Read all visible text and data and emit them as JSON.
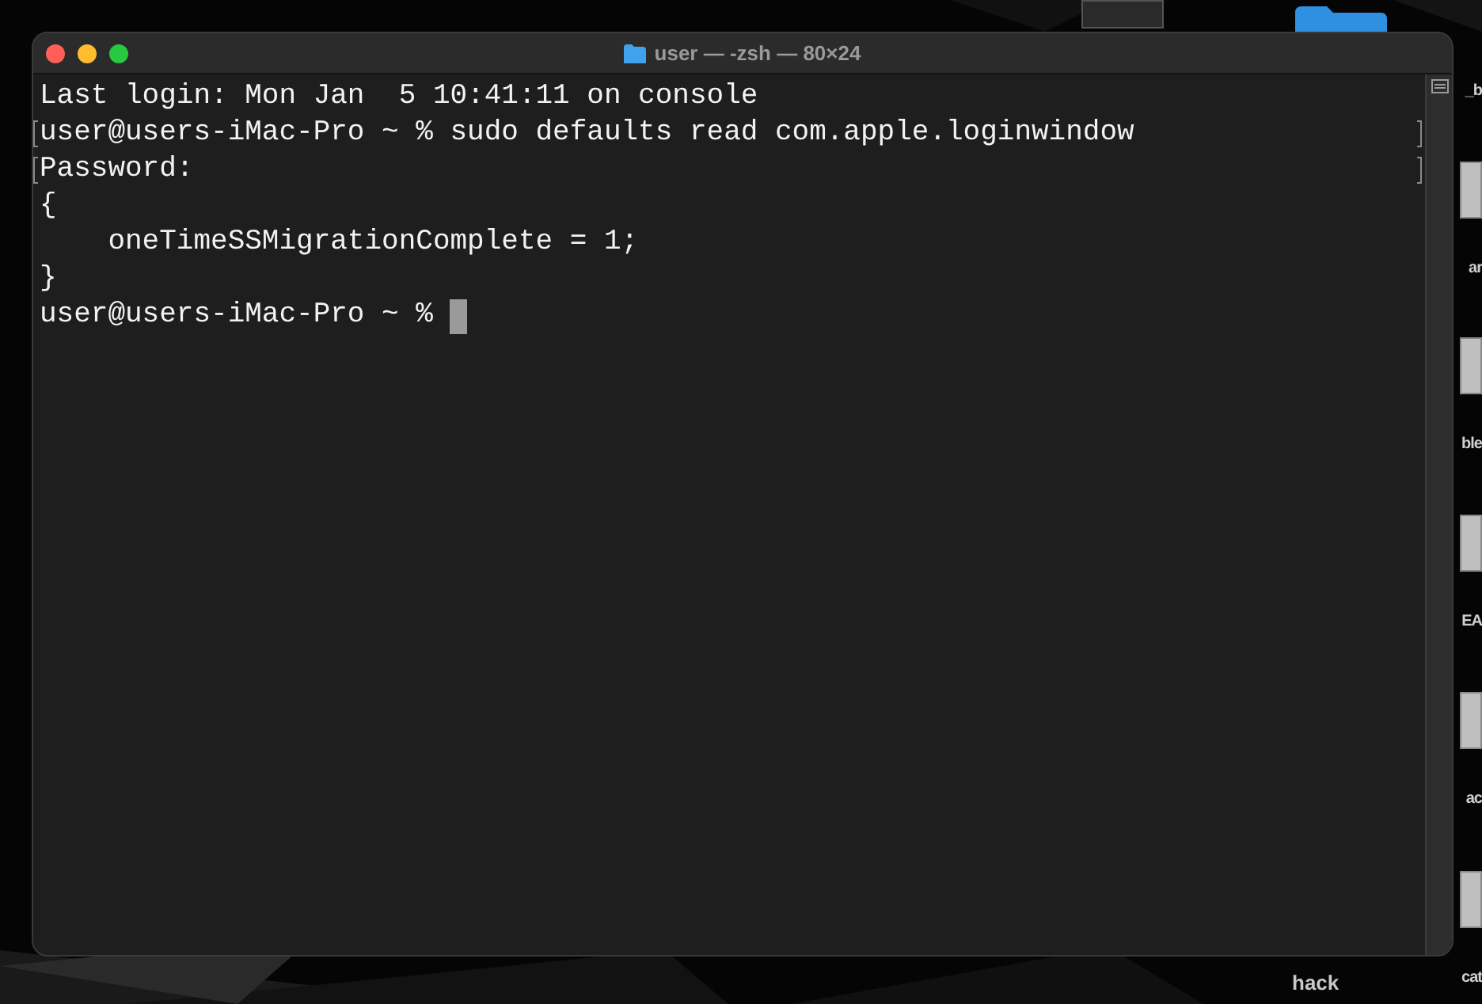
{
  "window": {
    "title": "user — -zsh — 80×24"
  },
  "terminal": {
    "lines": [
      {
        "text": "Last login: Mon Jan  5 10:41:11 on console",
        "marked": false,
        "cursor": false
      },
      {
        "text": "user@users-iMac-Pro ~ % sudo defaults read com.apple.loginwindow",
        "marked": true,
        "cursor": false
      },
      {
        "text": "Password:",
        "marked": true,
        "cursor": false
      },
      {
        "text": "{",
        "marked": false,
        "cursor": false
      },
      {
        "text": "    oneTimeSSMigrationComplete = 1;",
        "marked": false,
        "cursor": false
      },
      {
        "text": "}",
        "marked": false,
        "cursor": false
      },
      {
        "text": "user@users-iMac-Pro ~ % ",
        "marked": false,
        "cursor": true
      }
    ]
  },
  "desktop": {
    "side_labels": [
      "_b",
      "ar",
      "ble",
      "EA",
      "ac",
      "cat"
    ],
    "bottom_label": "hack"
  }
}
